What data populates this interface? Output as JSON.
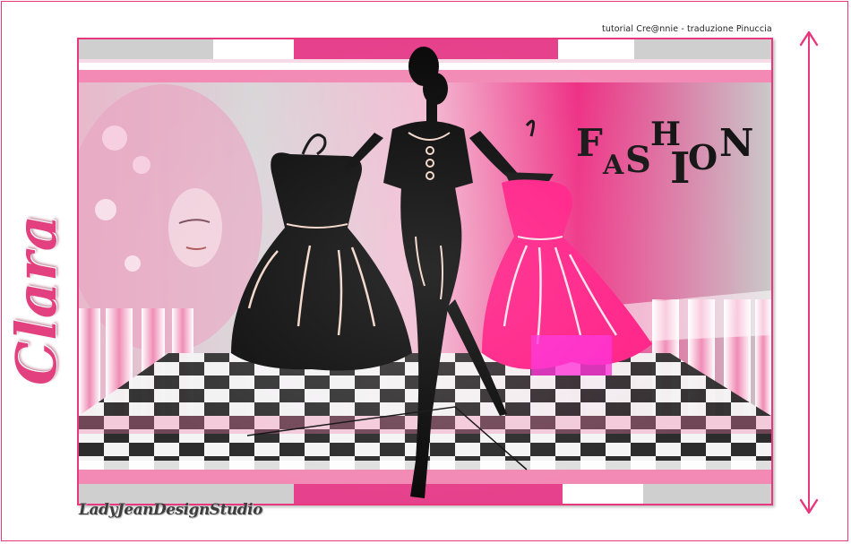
{
  "credit": {
    "text": "tutorial Cre@nnie - traduzione Pinuccia"
  },
  "title": {
    "text": "Clara"
  },
  "artwork": {
    "fashion_word": "FASHION"
  },
  "signature": {
    "text": "LadyJeanDesignStudio"
  },
  "colors": {
    "accent": "#e7387d",
    "hot_pink": "#ff1f86",
    "silhouette": "#0c0c0c",
    "soft_pink": "#f3b6cf"
  },
  "icons": {
    "arrow": "double-arrow-vertical-icon"
  }
}
